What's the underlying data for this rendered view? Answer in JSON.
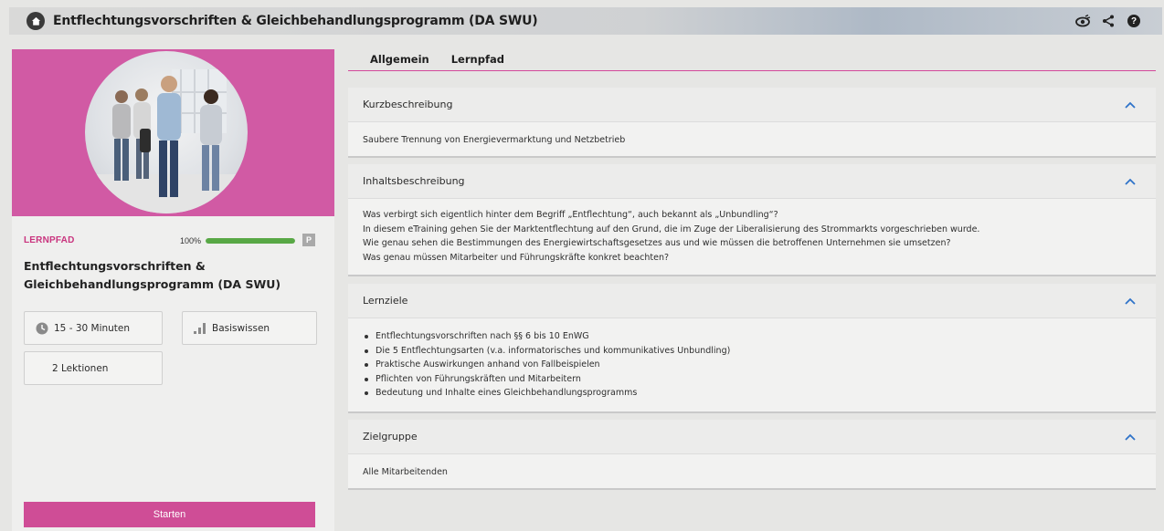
{
  "header": {
    "title": "Entflechtungsvorschriften & Gleichbehandlungsprogramm (DA SWU)",
    "icons": [
      "home-icon",
      "eye-icon",
      "share-icon",
      "help-icon"
    ],
    "help_glyph": "?"
  },
  "left": {
    "type_label": "LERNPFAD",
    "progress_text": "100%",
    "progress_value": 1.0,
    "badge": "P",
    "course_title": "Entflechtungsvorschriften & Gleichbehandlungsprogramm (DA SWU)",
    "duration": "15 - 30 Minuten",
    "level": "Basiswissen",
    "lessons": "2 Lektionen",
    "start_label": "Starten"
  },
  "tabs": [
    {
      "label": "Allgemein"
    },
    {
      "label": "Lernpfad"
    }
  ],
  "sections": {
    "kurz": {
      "title": "Kurzbeschreibung",
      "text": "Saubere Trennung von Energievermarktung und Netzbetrieb"
    },
    "inhalt": {
      "title": "Inhaltsbeschreibung",
      "lines": [
        "Was verbirgt sich eigentlich hinter dem Begriff „Entflechtung“, auch bekannt als „Unbundling“?",
        "In diesem eTraining gehen Sie der Marktentflechtung auf den Grund, die im Zuge der Liberalisierung des Strommarkts vorgeschrieben wurde.",
        "Wie genau sehen die Bestimmungen des Energiewirtschaftsgesetzes aus und wie müssen die betroffenen Unternehmen sie umsetzen?",
        "Was genau müssen Mitarbeiter und Führungskräfte konkret beachten?"
      ]
    },
    "ziele": {
      "title": "Lernziele",
      "items": [
        "Entflechtungsvorschriften nach §§ 6 bis 10 EnWG",
        "Die 5 Entflechtungsarten (v.a. informatorisches und kommunikatives Unbundling)",
        "Praktische Auswirkungen anhand von Fallbeispielen",
        "Pflichten von Führungskräften und Mitarbeitern",
        "Bedeutung und Inhalte eines Gleichbehandlungsprogramms"
      ]
    },
    "zielgruppe": {
      "title": "Zielgruppe",
      "text": "Alle Mitarbeitenden"
    }
  },
  "colors": {
    "accent": "#cf4d96",
    "hero": "#d15aa4",
    "progress": "#58a845"
  }
}
